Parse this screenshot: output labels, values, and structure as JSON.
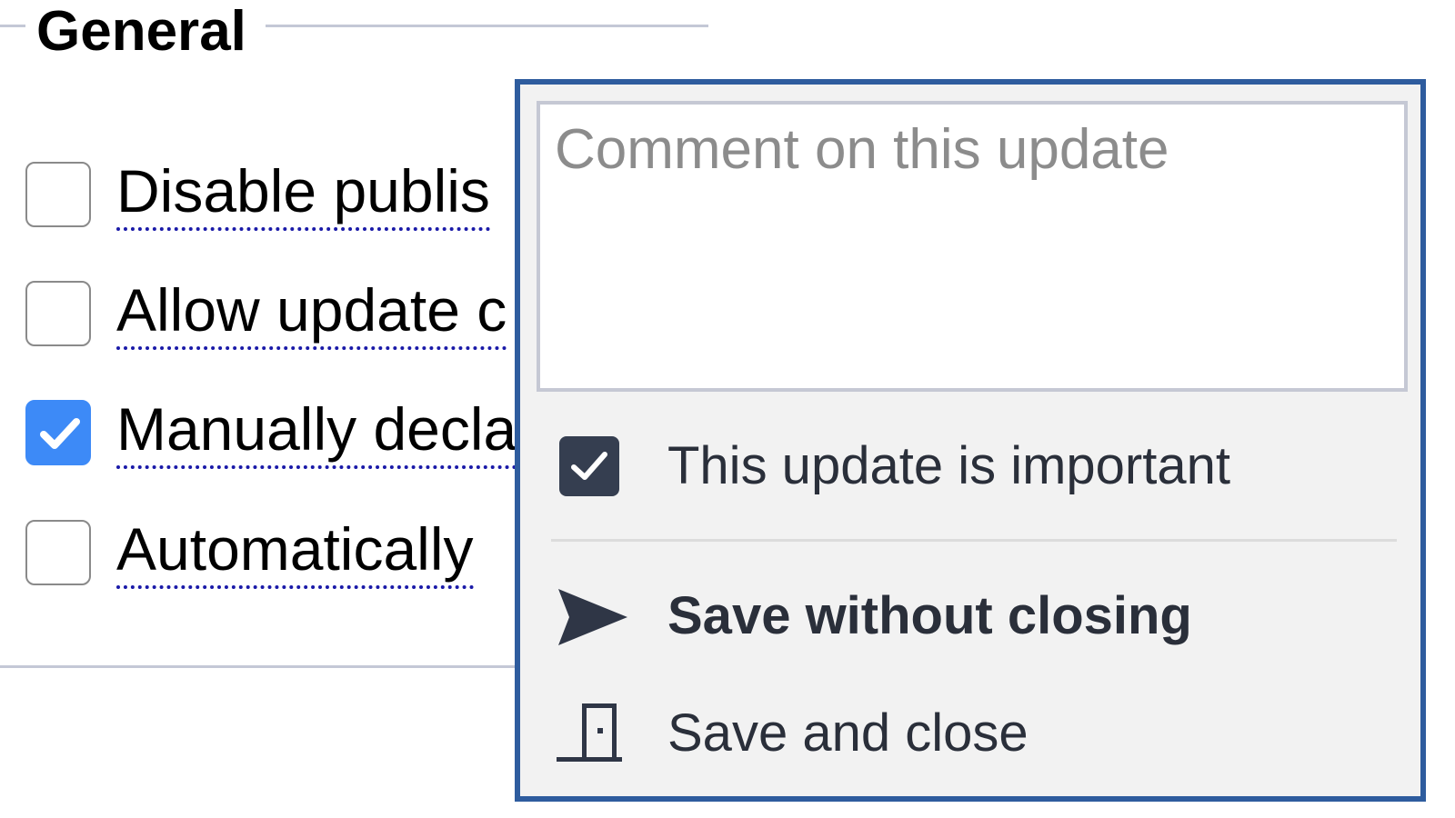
{
  "fieldset": {
    "legend": "General",
    "options": [
      {
        "label": "Disable publis",
        "checked": false
      },
      {
        "label": "Allow update c",
        "checked": false
      },
      {
        "label": "Manually decla",
        "checked": true
      },
      {
        "label": "Automatically",
        "checked": false
      }
    ]
  },
  "popup": {
    "comment_placeholder": "Comment on this update",
    "comment_value": "",
    "important_label": "This update is important",
    "important_checked": true,
    "save_without_closing": {
      "label": "Save without closing",
      "icon": "send-icon"
    },
    "save_and_close": {
      "label": "Save and close",
      "icon": "door-icon"
    }
  },
  "colors": {
    "accent_blue": "#3d8af7",
    "popup_border": "#2e5c9e",
    "dark_check": "#353e50",
    "link_underline": "#1a1aa8"
  }
}
